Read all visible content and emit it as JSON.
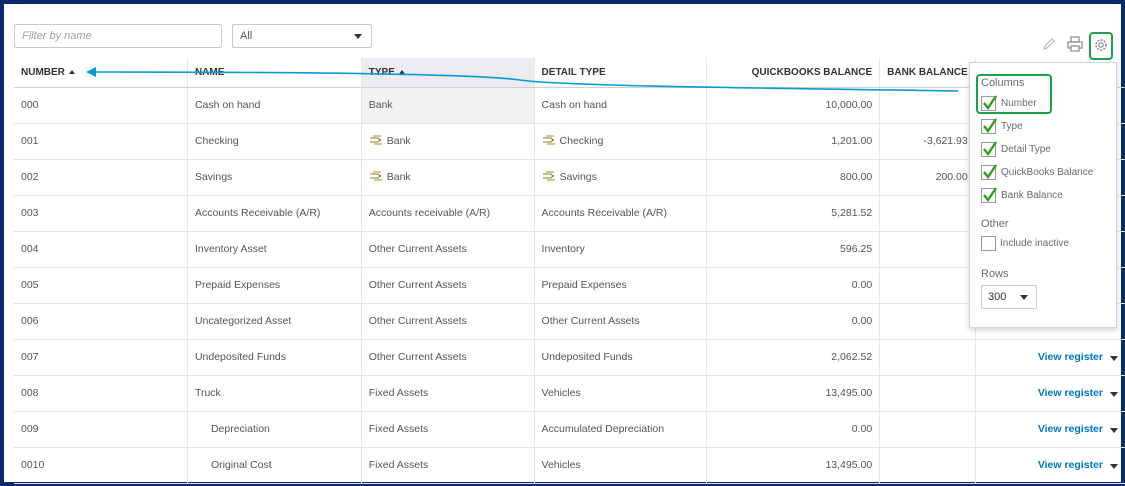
{
  "filter": {
    "placeholder": "Filter by name"
  },
  "type_filter": {
    "value": "All"
  },
  "toolbar": {
    "edit_icon": "pencil-icon",
    "print_icon": "printer-icon",
    "settings_icon": "gear-icon"
  },
  "columns": [
    "NUMBER",
    "NAME",
    "TYPE",
    "DETAIL TYPE",
    "QUICKBOOKS BALANCE",
    "BANK BALANCE"
  ],
  "rows": [
    {
      "number": "000",
      "name": "Cash on hand",
      "type": "Bank",
      "detail": "Cash on hand",
      "qb": "10,000.00",
      "bank": "",
      "icon": false,
      "action": ""
    },
    {
      "number": "001",
      "name": "Checking",
      "type": "Bank",
      "detail": "Checking",
      "qb": "1,201.00",
      "bank": "-3,621.93",
      "icon": true,
      "action": ""
    },
    {
      "number": "002",
      "name": "Savings",
      "type": "Bank",
      "detail": "Savings",
      "qb": "800.00",
      "bank": "200.00",
      "icon": true,
      "action": ""
    },
    {
      "number": "003",
      "name": "Accounts Receivable (A/R)",
      "type": "Accounts receivable (A/R)",
      "detail": "Accounts Receivable (A/R)",
      "qb": "5,281.52",
      "bank": "",
      "icon": false,
      "action": ""
    },
    {
      "number": "004",
      "name": "Inventory Asset",
      "type": "Other Current Assets",
      "detail": "Inventory",
      "qb": "596.25",
      "bank": "",
      "icon": false,
      "action": ""
    },
    {
      "number": "005",
      "name": "Prepaid Expenses",
      "type": "Other Current Assets",
      "detail": "Prepaid Expenses",
      "qb": "0.00",
      "bank": "",
      "icon": false,
      "action": ""
    },
    {
      "number": "006",
      "name": "Uncategorized Asset",
      "type": "Other Current Assets",
      "detail": "Other Current Assets",
      "qb": "0.00",
      "bank": "",
      "icon": false,
      "action": ""
    },
    {
      "number": "007",
      "name": "Undeposited Funds",
      "type": "Other Current Assets",
      "detail": "Undeposited Funds",
      "qb": "2,062.52",
      "bank": "",
      "icon": false,
      "action": "View register"
    },
    {
      "number": "008",
      "name": "Truck",
      "type": "Fixed Assets",
      "detail": "Vehicles",
      "qb": "13,495.00",
      "bank": "",
      "icon": false,
      "action": "View register"
    },
    {
      "number": "009",
      "name": "Depreciation",
      "type": "Fixed Assets",
      "detail": "Accumulated Depreciation",
      "qb": "0.00",
      "bank": "",
      "icon": false,
      "action": "View register",
      "sub": true
    },
    {
      "number": "0010",
      "name": "Original Cost",
      "type": "Fixed Assets",
      "detail": "Vehicles",
      "qb": "13,495.00",
      "bank": "",
      "icon": false,
      "action": "View register",
      "sub": true
    }
  ],
  "settings_panel": {
    "columns_heading": "Columns",
    "columns": [
      {
        "label": "Number",
        "checked": true
      },
      {
        "label": "Type",
        "checked": true
      },
      {
        "label": "Detail Type",
        "checked": true
      },
      {
        "label": "QuickBooks Balance",
        "checked": true
      },
      {
        "label": "Bank Balance",
        "checked": true
      }
    ],
    "other_heading": "Other",
    "include_inactive": {
      "label": "Include inactive",
      "checked": false
    },
    "rows_heading": "Rows",
    "rows_value": "300"
  },
  "colors": {
    "border": "#0b2a6b",
    "link": "#0077c5",
    "highlight": "#1aa34a",
    "check": "#2ca01c",
    "arrow": "#0a9ad8"
  }
}
